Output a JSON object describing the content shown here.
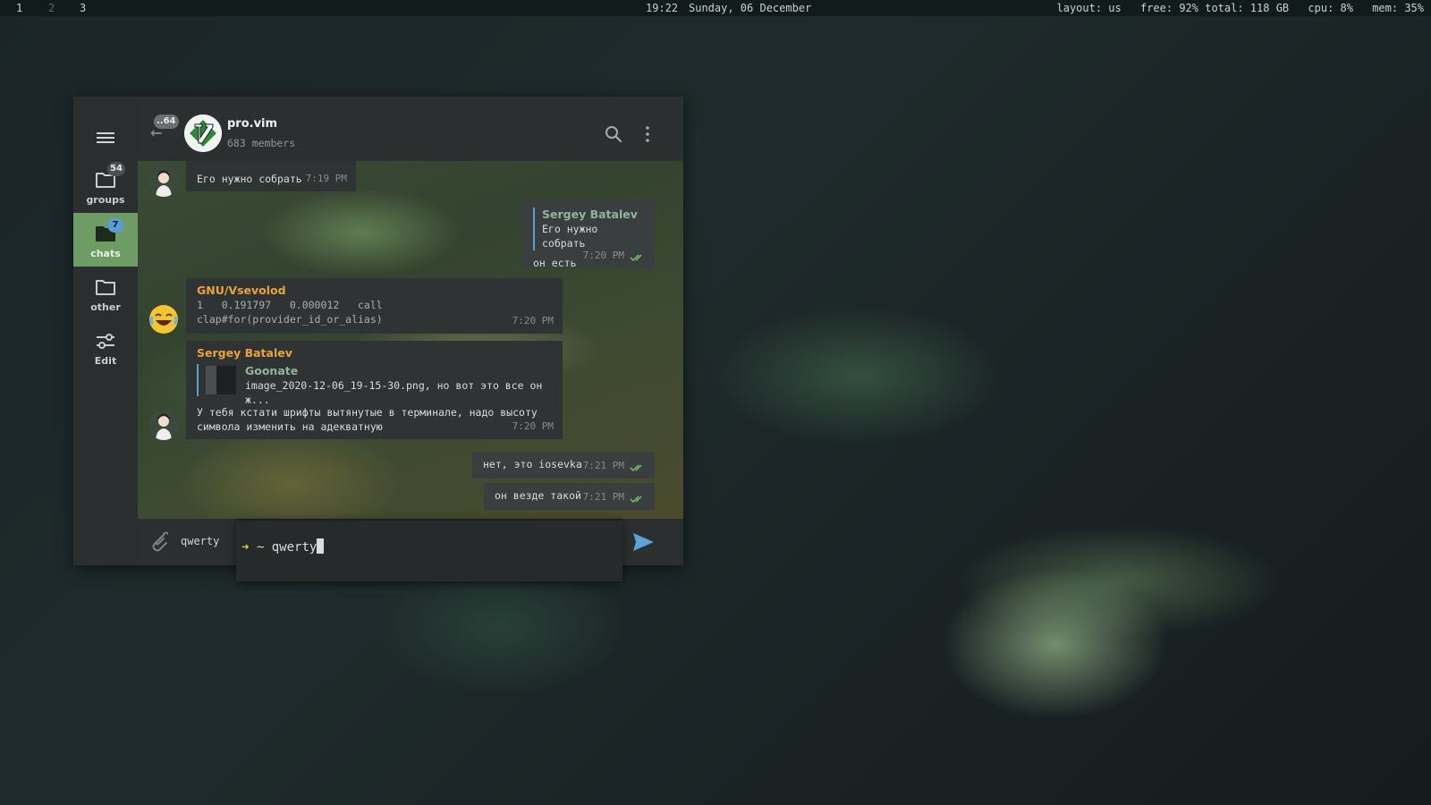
{
  "topbar": {
    "workspaces": [
      "1",
      "2",
      "3"
    ],
    "clock": "19:22",
    "date": "Sunday, 06 December",
    "layout": "layout: us",
    "disk": "free: 92% total: 118 GB",
    "cpu": "cpu:  8%",
    "mem": "mem: 35%"
  },
  "sidebar": {
    "folders": [
      {
        "label": "groups",
        "badge": "54"
      },
      {
        "label": "chats",
        "badge": "7"
      },
      {
        "label": "other"
      },
      {
        "label": "Edit"
      }
    ]
  },
  "header": {
    "back_badge": "..64",
    "title": "pro.vim",
    "members": "683 members"
  },
  "messages": {
    "m1": {
      "text": "Его нужно собрать",
      "time": "7:19 PM"
    },
    "m2": {
      "quote_name": "Sergey Batalev",
      "quote_text": "Его нужно собрать",
      "text": "он есть",
      "time": "7:20 PM"
    },
    "m3": {
      "sender": "GNU/Vsevolod",
      "line1": "1   0.191797   0.000012   call",
      "line2": "clap#for(provider_id_or_alias)",
      "time": "7:20 PM"
    },
    "m4": {
      "sender": "Sergey Batalev",
      "quote_name": "Goonate",
      "quote_text": "image_2020-12-06_19-15-30.png, но вот это все он ж...",
      "line1": "У тебя кстати шрифты вытянутые в терминале, надо высоту",
      "line2": "символа изменить на адекватную",
      "time": "7:20 PM"
    },
    "m5": {
      "text": "нет, это iosevka",
      "time": "7:21 PM"
    },
    "m6": {
      "text": "он везде такой",
      "time": "7:21 PM"
    }
  },
  "composer": {
    "text": "qwerty"
  },
  "terminal": {
    "prompt": "~",
    "text": "qwerty"
  },
  "colors": {
    "accent_green": "#6d9d65",
    "sender_orange": "#e8a33c",
    "send_blue": "#5ba3d6"
  }
}
